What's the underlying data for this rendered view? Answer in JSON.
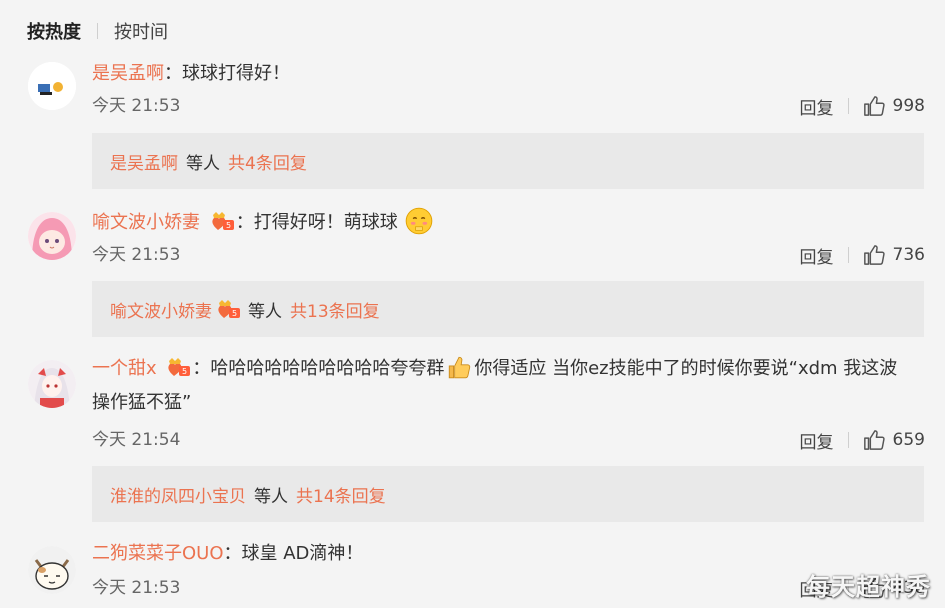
{
  "sort": {
    "active": "按热度",
    "other": "按时间"
  },
  "comments": [
    {
      "user": "是吴孟啊",
      "text": "：球球打得好！",
      "time": "今天 21:53",
      "reply_label": "回复",
      "likes": "998",
      "replies": {
        "user": "是吴孟啊",
        "mid": "等人",
        "link": "共4条回复"
      }
    },
    {
      "user": "喻文波小娇妻",
      "text": "：打得好呀！萌球球",
      "time": "今天 21:53",
      "reply_label": "回复",
      "likes": "736",
      "replies": {
        "user": "喻文波小娇妻",
        "mid": "等人",
        "link": "共13条回复"
      }
    },
    {
      "user": "一个甜x",
      "text_a": "：哈哈哈哈哈哈哈哈哈哈夸夸群",
      "text_b": "你得适应 当你ez技能中了的时候你要说“xdm 我这波操作猛不猛”",
      "time": "今天 21:54",
      "reply_label": "回复",
      "likes": "659",
      "replies": {
        "user": "淮淮的凤四小宝贝",
        "mid": "等人",
        "link": "共14条回复"
      }
    },
    {
      "user": "二狗菜菜子OUO",
      "text": "：球皇 AD滴神！",
      "time": "今天 21:53",
      "reply_label": "回复",
      "likes": "430"
    }
  ],
  "watermark": "每天超神秀",
  "colors": {
    "username": "#eb7350",
    "background": "#f4f4f4",
    "reply_box": "#e9e9e9"
  }
}
